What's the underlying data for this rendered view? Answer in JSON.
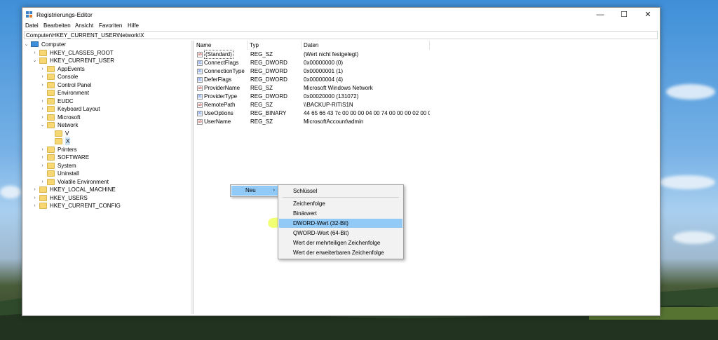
{
  "window": {
    "title": "Registrierungs-Editor",
    "minimize": "—",
    "maximize": "☐",
    "close": "✕"
  },
  "menu": [
    "Datei",
    "Bearbeiten",
    "Ansicht",
    "Favoriten",
    "Hilfe"
  ],
  "address": "Computer\\HKEY_CURRENT_USER\\Network\\X",
  "tree": {
    "root": "Computer",
    "items": [
      {
        "label": "HKEY_CLASSES_ROOT",
        "level": 1,
        "expander": "›"
      },
      {
        "label": "HKEY_CURRENT_USER",
        "level": 1,
        "expander": "⌄"
      },
      {
        "label": "AppEvents",
        "level": 2,
        "expander": "›"
      },
      {
        "label": "Console",
        "level": 2,
        "expander": "›"
      },
      {
        "label": "Control Panel",
        "level": 2,
        "expander": "›"
      },
      {
        "label": "Environment",
        "level": 2,
        "expander": ""
      },
      {
        "label": "EUDC",
        "level": 2,
        "expander": "›"
      },
      {
        "label": "Keyboard Layout",
        "level": 2,
        "expander": "›"
      },
      {
        "label": "Microsoft",
        "level": 2,
        "expander": "›"
      },
      {
        "label": "Network",
        "level": 2,
        "expander": "⌄"
      },
      {
        "label": "V",
        "level": 3,
        "expander": ""
      },
      {
        "label": "X",
        "level": 3,
        "expander": "",
        "selected": true
      },
      {
        "label": "Printers",
        "level": 2,
        "expander": "›"
      },
      {
        "label": "SOFTWARE",
        "level": 2,
        "expander": "›"
      },
      {
        "label": "System",
        "level": 2,
        "expander": "›"
      },
      {
        "label": "Uninstall",
        "level": 2,
        "expander": ""
      },
      {
        "label": "Volatile Environment",
        "level": 2,
        "expander": "›"
      },
      {
        "label": "HKEY_LOCAL_MACHINE",
        "level": 1,
        "expander": "›"
      },
      {
        "label": "HKEY_USERS",
        "level": 1,
        "expander": "›"
      },
      {
        "label": "HKEY_CURRENT_CONFIG",
        "level": 1,
        "expander": "›"
      }
    ]
  },
  "columns": [
    "Name",
    "Typ",
    "Daten"
  ],
  "values": [
    {
      "name": "(Standard)",
      "type": "REG_SZ",
      "data": "(Wert nicht festgelegt)",
      "icon": "ab"
    },
    {
      "name": "ConnectFlags",
      "type": "REG_DWORD",
      "data": "0x00000000 (0)",
      "icon": "01"
    },
    {
      "name": "ConnectionType",
      "type": "REG_DWORD",
      "data": "0x00000001 (1)",
      "icon": "01"
    },
    {
      "name": "DeferFlags",
      "type": "REG_DWORD",
      "data": "0x00000004 (4)",
      "icon": "01"
    },
    {
      "name": "ProviderName",
      "type": "REG_SZ",
      "data": "Microsoft Windows Network",
      "icon": "ab"
    },
    {
      "name": "ProviderType",
      "type": "REG_DWORD",
      "data": "0x00020000 (131072)",
      "icon": "01"
    },
    {
      "name": "RemotePath",
      "type": "REG_SZ",
      "data": "\\\\BACKUP-RIT\\S1N",
      "icon": "ab"
    },
    {
      "name": "UseOptions",
      "type": "REG_BINARY",
      "data": "44 65 66 43 7c 00 00 00 04 00 74 00 00 00 02 00 02 00...",
      "icon": "01"
    },
    {
      "name": "UserName",
      "type": "REG_SZ",
      "data": "MicrosoftAccount\\admin",
      "icon": "ab"
    }
  ],
  "context_menu": {
    "new_label": "Neu",
    "arrow": "›"
  },
  "submenu": {
    "items": [
      "Schlüssel",
      "Zeichenfolge",
      "Binärwert",
      "DWORD-Wert (32-Bit)",
      "QWORD-Wert (64-Bit)",
      "Wert der mehrteiligen Zeichenfolge",
      "Wert der erweiterbaren Zeichenfolge"
    ],
    "highlighted_index": 3
  },
  "colors": {
    "selection": "#91c9f7",
    "highlighter": "#e6ff00",
    "folder": "#f7d774"
  }
}
